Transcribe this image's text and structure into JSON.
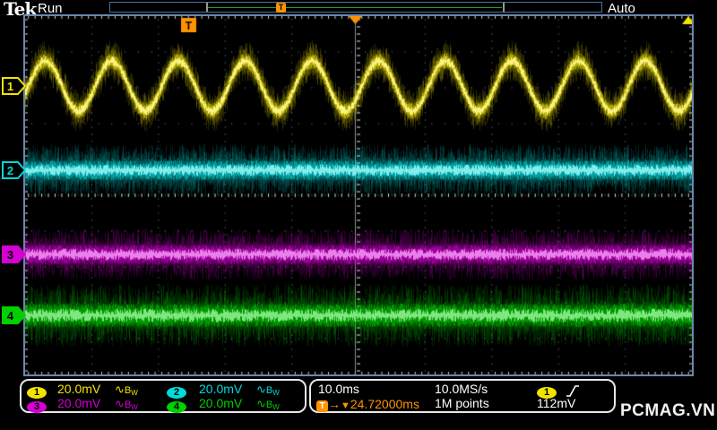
{
  "header": {
    "logo": "Tek",
    "acq_status": "Run",
    "trigger_mode": "Auto",
    "record_line_color": "#1ea51e",
    "record_trigger_marker": "T"
  },
  "colors": {
    "accent_orange": "#ff9400",
    "graticule_frame": "#6d87ab",
    "readout_white": "#f0f0f0"
  },
  "icons": {
    "sine_glyph": "∿",
    "bw_b": "B",
    "bw_w": "W",
    "arrow_right": "→",
    "tri_down": "▼",
    "tri_up": "▲"
  },
  "channels": [
    {
      "label": "1",
      "scale": "20.0mV",
      "color": "#f2e400",
      "marker_style": "outline"
    },
    {
      "label": "2",
      "scale": "20.0mV",
      "color": "#00dbdb",
      "marker_style": "outline"
    },
    {
      "label": "3",
      "scale": "20.0mV",
      "color": "#d400d4",
      "marker_style": "filled"
    },
    {
      "label": "4",
      "scale": "20.0mV",
      "color": "#00cf00",
      "marker_style": "filled"
    }
  ],
  "horizontal": {
    "time_per_div": "10.0ms",
    "sample_rate": "10.0MS/s",
    "record_length": "1M points"
  },
  "trigger": {
    "icon": "T",
    "source": "1",
    "slope": "rising",
    "delay": "24.72000ms",
    "level": "112mV"
  },
  "watermark": "PCMAG.VN",
  "chart_data": {
    "type": "line",
    "title": "Tektronix 4-channel oscilloscope acquisition",
    "time_per_div_ms": 10,
    "time_window_ms": 100,
    "volts_per_div_mV": 20,
    "divisions": {
      "horizontal": 10,
      "vertical": 10
    },
    "trigger": {
      "source": "CH1",
      "level_mV": 112,
      "delay_ms": 24.72,
      "slope": "rising",
      "mode": "Auto"
    },
    "sample_rate": "10.0MS/s",
    "record_length": "1M points",
    "series": [
      {
        "name": "CH1",
        "color": "#f2e400",
        "waveform": "sine",
        "frequency_hz": 100,
        "amplitude_mV": 14,
        "offset_div": 3.05,
        "noise_mV_rms": 4,
        "description": "noisy ~100 Hz sine, ~1 cycle per division, ~28 mVpp"
      },
      {
        "name": "CH2",
        "color": "#00dbdb",
        "waveform": "dc",
        "frequency_hz": 0,
        "amplitude_mV": 0,
        "offset_div": 0.7,
        "noise_mV_rms": 5,
        "description": "flat noisy baseline"
      },
      {
        "name": "CH3",
        "color": "#d400d4",
        "waveform": "dc",
        "frequency_hz": 0,
        "amplitude_mV": 0,
        "offset_div": -1.65,
        "noise_mV_rms": 5,
        "description": "flat noisy baseline"
      },
      {
        "name": "CH4",
        "color": "#00cf00",
        "waveform": "dc",
        "frequency_hz": 0,
        "amplitude_mV": 0,
        "offset_div": -3.35,
        "noise_mV_rms": 6,
        "description": "flat noisy baseline"
      }
    ]
  }
}
